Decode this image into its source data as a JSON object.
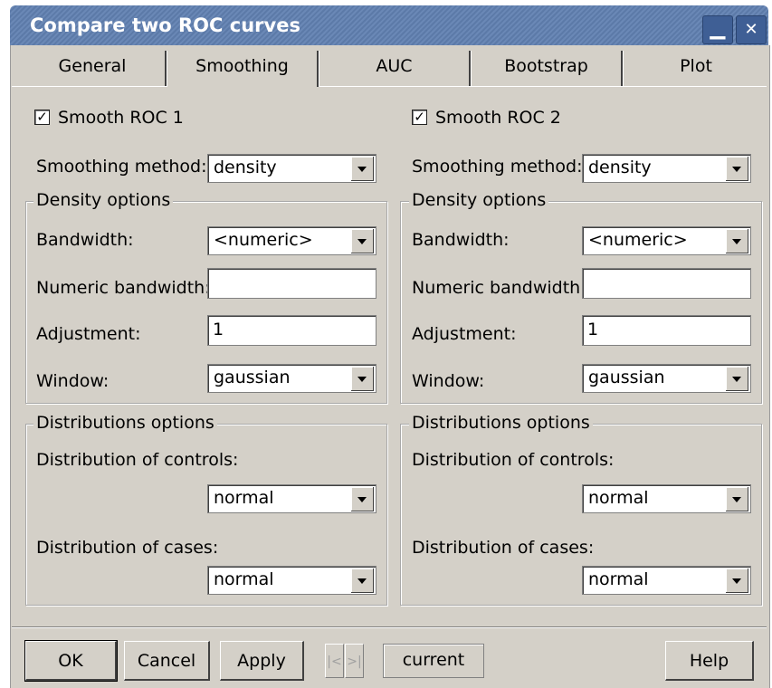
{
  "window": {
    "title": "Compare two ROC curves",
    "minimize_glyph": "▁",
    "close_glyph": "✕"
  },
  "tabs": [
    {
      "label": "General"
    },
    {
      "label": "Smoothing",
      "active": true
    },
    {
      "label": "AUC"
    },
    {
      "label": "Bootstrap"
    },
    {
      "label": "Plot"
    }
  ],
  "roc1": {
    "smooth_label": "Smooth ROC 1",
    "smooth_checked": "✓",
    "method_label": "Smoothing method:",
    "method_value": "density",
    "density_title": "Density options",
    "bandwidth_label": "Bandwidth:",
    "bandwidth_value": "<numeric>",
    "numeric_bandwidth_label": "Numeric bandwidth:",
    "numeric_bandwidth_value": "",
    "adjustment_label": "Adjustment:",
    "adjustment_value": "1",
    "window_label": "Window:",
    "window_value": "gaussian",
    "dist_title": "Distributions options",
    "controls_label": "Distribution of controls:",
    "controls_value": "normal",
    "cases_label": "Distribution of cases:",
    "cases_value": "normal"
  },
  "roc2": {
    "smooth_label": "Smooth ROC 2",
    "smooth_checked": "✓",
    "method_label": "Smoothing method:",
    "method_value": "density",
    "density_title": "Density options",
    "bandwidth_label": "Bandwidth:",
    "bandwidth_value": "<numeric>",
    "numeric_bandwidth_label": "Numeric bandwidth:",
    "numeric_bandwidth_value": "",
    "adjustment_label": "Adjustment:",
    "adjustment_value": "1",
    "window_label": "Window:",
    "window_value": "gaussian",
    "dist_title": "Distributions options",
    "controls_label": "Distribution of controls:",
    "controls_value": "normal",
    "cases_label": "Distribution of cases:",
    "cases_value": "normal"
  },
  "footer": {
    "ok": "OK",
    "cancel": "Cancel",
    "apply": "Apply",
    "prev_glyph": "|<",
    "next_glyph": ">|",
    "current": "current",
    "help": "Help"
  }
}
